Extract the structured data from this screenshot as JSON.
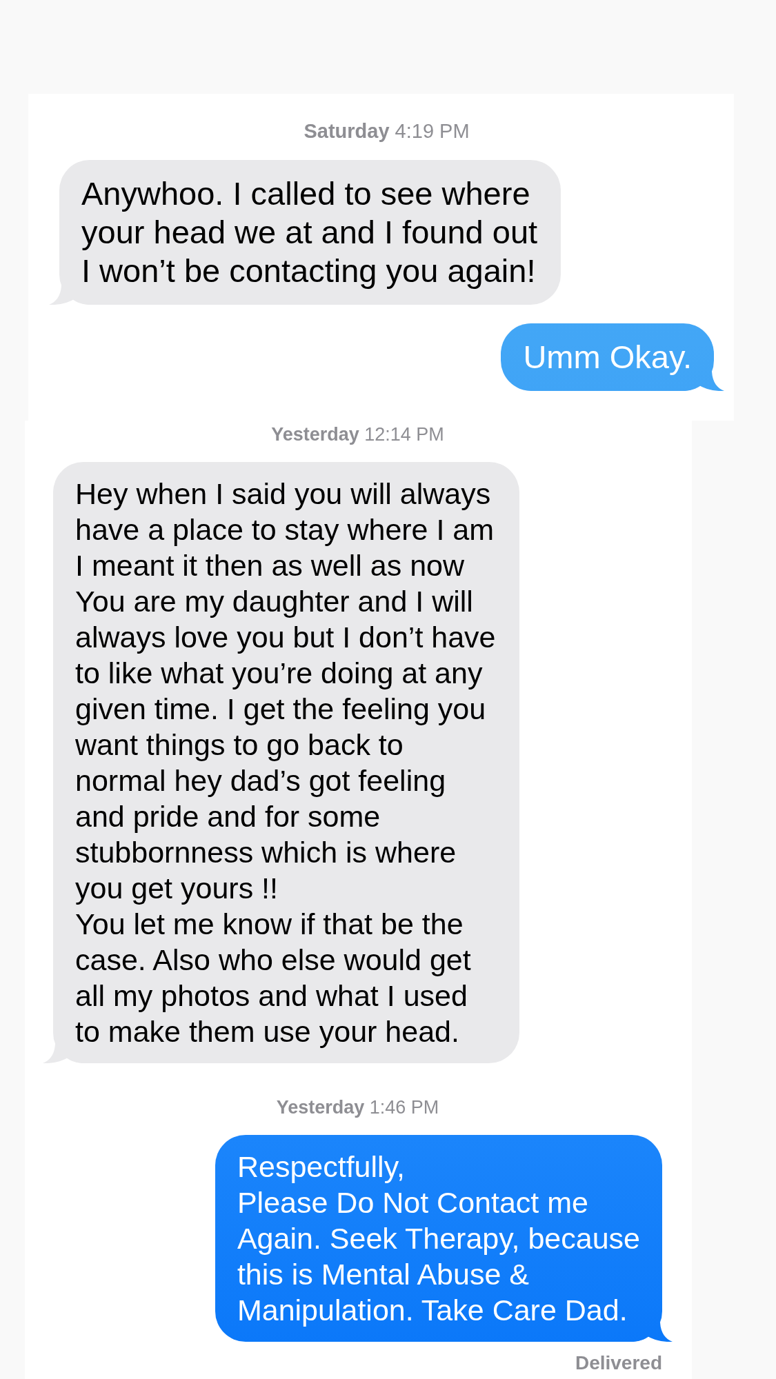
{
  "panels": [
    {
      "items": [
        {
          "kind": "timestamp",
          "text": "**Saturday** 4:19 PM"
        },
        {
          "kind": "received",
          "lines": [
            "Anywhoo. I called to see where",
            "your head we at and I found out",
            "I won’t be contacting you again!"
          ]
        },
        {
          "kind": "sent",
          "lines": [
            "Umm Okay."
          ]
        }
      ]
    },
    {
      "items": [
        {
          "kind": "timestamp",
          "text": "**Yesterday** 12:14 PM"
        },
        {
          "kind": "received",
          "lines": [
            "Hey when I said you will always",
            "have a place to stay where I am",
            "I meant it then as well as now",
            "You are my daughter and I will",
            "always love you but I don’t have",
            "to like what you’re doing at any",
            "given time. I get the feeling you",
            "want things to go back to",
            "normal hey dad’s got feeling",
            "and pride and for some",
            "stubbornness which is where",
            "you get yours !!",
            "You let me know if that be the",
            "case. Also who else would get",
            "all my photos and what I used",
            "to make them use your head."
          ]
        },
        {
          "kind": "timestamp",
          "text": "**Yesterday** 1:46 PM"
        },
        {
          "kind": "sent",
          "lines": [
            "Respectfully,",
            "Please Do Not Contact me",
            "Again. Seek Therapy, because",
            "this is Mental Abuse &",
            "Manipulation. Take Care Dad."
          ]
        },
        {
          "kind": "status",
          "text": "**Delivered**"
        }
      ]
    }
  ]
}
